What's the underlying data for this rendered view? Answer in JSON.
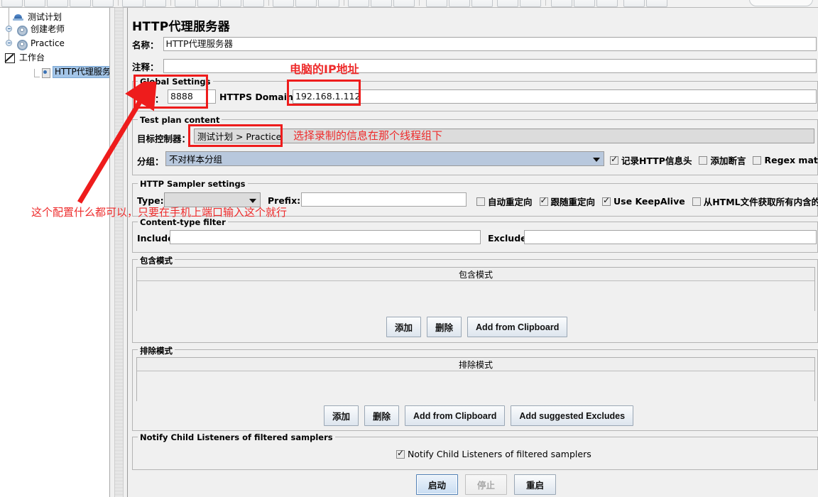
{
  "window": {
    "title": "HTTP代理服务器"
  },
  "tree": {
    "nodes": [
      {
        "label": "测试计划",
        "icon": "test-plan-icon",
        "selected": false
      },
      {
        "label": "创建老师",
        "icon": "thread-group-icon",
        "selected": false
      },
      {
        "label": "Practice",
        "icon": "thread-group-icon",
        "selected": false
      },
      {
        "label": "工作台",
        "icon": "workbench-icon",
        "selected": false
      },
      {
        "label": "HTTP代理服务器",
        "icon": "http-proxy-icon",
        "selected": true
      }
    ]
  },
  "panel": {
    "title": "HTTP代理服务器",
    "name_label": "名称：",
    "name_value": "HTTP代理服务器",
    "comment_label": "注释：",
    "comment_value": ""
  },
  "global_settings": {
    "title": "Global Settings",
    "port_label": "端口：",
    "port_value": "8888",
    "https_domains_label": "HTTPS Domains",
    "https_domains_value": "192.168.1.112"
  },
  "test_plan_content": {
    "title": "Test plan content",
    "target_controller_label": "目标控制器：",
    "target_controller_value": "测试计划 > Practice",
    "grouping_label": "分组：",
    "grouping_value": "不对样本分组",
    "checkboxes": [
      {
        "label": "记录HTTP信息头",
        "checked": true
      },
      {
        "label": "添加断言",
        "checked": false
      },
      {
        "label": "Regex matching",
        "checked": false
      }
    ]
  },
  "http_sampler_settings": {
    "title": "HTTP Sampler settings",
    "type_label": "Type:",
    "type_value": "",
    "prefix_label": "Prefix:",
    "prefix_value": "",
    "checkboxes": [
      {
        "label": "自动重定向",
        "checked": false
      },
      {
        "label": "跟随重定向",
        "checked": true
      },
      {
        "label": "Use KeepAlive",
        "checked": true
      },
      {
        "label": "从HTML文件获取所有内含的资源",
        "checked": false
      }
    ]
  },
  "content_type_filter": {
    "title": "Content-type filter",
    "include_label": "Include:",
    "include_value": "",
    "exclude_label": "Exclude:",
    "exclude_value": ""
  },
  "include_patterns": {
    "title": "包含模式",
    "column_header": "包含模式",
    "rows": [],
    "buttons": [
      "添加",
      "删除",
      "Add from Clipboard"
    ]
  },
  "exclude_patterns": {
    "title": "排除模式",
    "column_header": "排除模式",
    "rows": [],
    "buttons": [
      "添加",
      "删除",
      "Add from Clipboard",
      "Add suggested Excludes"
    ]
  },
  "notify": {
    "title": "Notify Child Listeners of filtered samplers",
    "checkbox_label": "Notify Child Listeners of filtered samplers",
    "checked": true
  },
  "actions": {
    "start": "启动",
    "stop": "停止",
    "restart": "重启",
    "stop_disabled": true,
    "start_focused": true
  },
  "annotations": {
    "color": "#ee2b2b",
    "ip_note": "电脑的IP地址",
    "controller_note": "选择录制的信息在那个线程组下",
    "port_note": "这个配置什么都可以，只要在手机上端口输入这个就行"
  }
}
